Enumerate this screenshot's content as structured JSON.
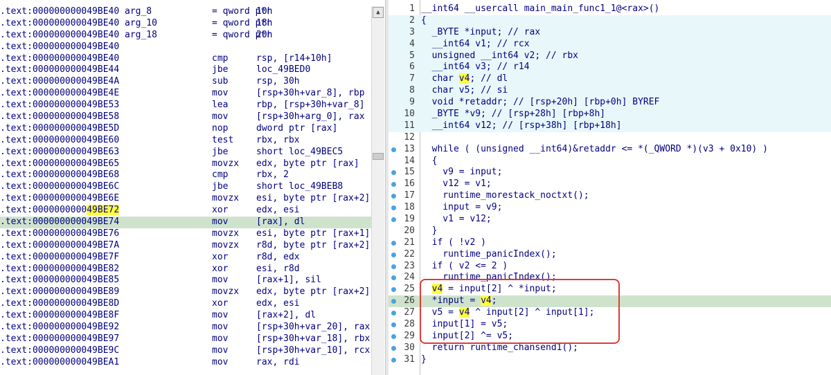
{
  "disassembly": {
    "rows": [
      {
        "addr": ".text:000000000049BE40",
        "label": "arg_8",
        "mnemonic": "= qword ptr",
        "operand": "10h"
      },
      {
        "addr": ".text:000000000049BE40",
        "label": "arg_10",
        "mnemonic": "= qword ptr",
        "operand": "18h"
      },
      {
        "addr": ".text:000000000049BE40",
        "label": "arg_18",
        "mnemonic": "= qword ptr",
        "operand": "20h"
      },
      {
        "addr": ".text:000000000049BE40",
        "label": "",
        "mnemonic": "",
        "operand": ""
      },
      {
        "addr": ".text:000000000049BE40",
        "label": "",
        "mnemonic": "cmp",
        "operand": "rsp, [r14+10h]"
      },
      {
        "addr": ".text:000000000049BE44",
        "label": "",
        "mnemonic": "jbe",
        "operand": "loc_49BED0"
      },
      {
        "addr": ".text:000000000049BE4A",
        "label": "",
        "mnemonic": "sub",
        "operand": "rsp, 30h"
      },
      {
        "addr": ".text:000000000049BE4E",
        "label": "",
        "mnemonic": "mov",
        "operand": "[rsp+30h+var_8], rbp"
      },
      {
        "addr": ".text:000000000049BE53",
        "label": "",
        "mnemonic": "lea",
        "operand": "rbp, [rsp+30h+var_8]"
      },
      {
        "addr": ".text:000000000049BE58",
        "label": "",
        "mnemonic": "mov",
        "operand": "[rsp+30h+arg_0], rax"
      },
      {
        "addr": ".text:000000000049BE5D",
        "label": "",
        "mnemonic": "nop",
        "operand": "dword ptr [rax]"
      },
      {
        "addr": ".text:000000000049BE60",
        "label": "",
        "mnemonic": "test",
        "operand": "rbx, rbx"
      },
      {
        "addr": ".text:000000000049BE63",
        "label": "",
        "mnemonic": "jbe",
        "operand": "short loc_49BEC5"
      },
      {
        "addr": ".text:000000000049BE65",
        "label": "",
        "mnemonic": "movzx",
        "operand": "edx, byte ptr [rax]"
      },
      {
        "addr": ".text:000000000049BE68",
        "label": "",
        "mnemonic": "cmp",
        "operand": "rbx, 2"
      },
      {
        "addr": ".text:000000000049BE6C",
        "label": "",
        "mnemonic": "jbe",
        "operand": "short loc_49BEB8"
      },
      {
        "addr": ".text:000000000049BE6E",
        "label": "",
        "mnemonic": "movzx",
        "operand": "esi, byte ptr [rax+2]"
      },
      {
        "addr": ".text:000000000049BE72",
        "label": "",
        "mnemonic": "xor",
        "operand": "edx, esi"
      },
      {
        "addr": ".text:000000000049BE74",
        "label": "",
        "mnemonic": "mov",
        "operand": "[rax], dl"
      },
      {
        "addr": ".text:000000000049BE76",
        "label": "",
        "mnemonic": "movzx",
        "operand": "esi, byte ptr [rax+1]"
      },
      {
        "addr": ".text:000000000049BE7A",
        "label": "",
        "mnemonic": "movzx",
        "operand": "r8d, byte ptr [rax+2]"
      },
      {
        "addr": ".text:000000000049BE7F",
        "label": "",
        "mnemonic": "xor",
        "operand": "r8d, edx"
      },
      {
        "addr": ".text:000000000049BE82",
        "label": "",
        "mnemonic": "xor",
        "operand": "esi, r8d"
      },
      {
        "addr": ".text:000000000049BE85",
        "label": "",
        "mnemonic": "mov",
        "operand": "[rax+1], sil"
      },
      {
        "addr": ".text:000000000049BE89",
        "label": "",
        "mnemonic": "movzx",
        "operand": "edx, byte ptr [rax+2]"
      },
      {
        "addr": ".text:000000000049BE8D",
        "label": "",
        "mnemonic": "xor",
        "operand": "edx, esi"
      },
      {
        "addr": ".text:000000000049BE8F",
        "label": "",
        "mnemonic": "mov",
        "operand": "[rax+2], dl"
      },
      {
        "addr": ".text:000000000049BE92",
        "label": "",
        "mnemonic": "mov",
        "operand": "[rsp+30h+var_20], rax"
      },
      {
        "addr": ".text:000000000049BE97",
        "label": "",
        "mnemonic": "mov",
        "operand": "[rsp+30h+var_18], rbx"
      },
      {
        "addr": ".text:000000000049BE9C",
        "label": "",
        "mnemonic": "mov",
        "operand": "[rsp+30h+var_10], rcx"
      },
      {
        "addr": ".text:000000000049BEA1",
        "label": "",
        "mnemonic": "mov",
        "operand": "rax, rdi"
      }
    ],
    "highlighted_address_part": "49BE72",
    "selected_row_addr": ".text:000000000049BE74"
  },
  "pseudocode": {
    "lines": [
      {
        "n": "1",
        "text": "__int64 __usercall main_main_func1_1@<rax>()"
      },
      {
        "n": "2",
        "text": "{"
      },
      {
        "n": "3",
        "text": "  _BYTE *input; // rax"
      },
      {
        "n": "4",
        "text": "  __int64 v1; // rcx"
      },
      {
        "n": "5",
        "text": "  unsigned __int64 v2; // rbx"
      },
      {
        "n": "6",
        "text": "  __int64 v3; // r14"
      },
      {
        "n": "7",
        "text": "  char v4; // dl"
      },
      {
        "n": "8",
        "text": "  char v5; // si"
      },
      {
        "n": "9",
        "text": "  void *retaddr; // [rsp+20h] [rbp+0h] BYREF"
      },
      {
        "n": "10",
        "text": "  _BYTE *v9; // [rsp+28h] [rbp+8h]"
      },
      {
        "n": "11",
        "text": "  __int64 v12; // [rsp+38h] [rbp+18h]"
      },
      {
        "n": "12",
        "text": ""
      },
      {
        "n": "13",
        "text": "  while ( (unsigned __int64)&retaddr <= *(_QWORD *)(v3 + 0x10) )"
      },
      {
        "n": "14",
        "text": "  {"
      },
      {
        "n": "15",
        "text": "    v9 = input;"
      },
      {
        "n": "16",
        "text": "    v12 = v1;"
      },
      {
        "n": "17",
        "text": "    runtime_morestack_noctxt();"
      },
      {
        "n": "18",
        "text": "    input = v9;"
      },
      {
        "n": "19",
        "text": "    v1 = v12;"
      },
      {
        "n": "20",
        "text": "  }"
      },
      {
        "n": "21",
        "text": "  if ( !v2 )"
      },
      {
        "n": "22",
        "text": "    runtime_panicIndex();"
      },
      {
        "n": "23",
        "text": "  if ( v2 <= 2 )"
      },
      {
        "n": "24",
        "text": "    runtime_panicIndex();"
      },
      {
        "n": "25",
        "text": "  v4 = input[2] ^ *input;"
      },
      {
        "n": "26",
        "text": "  *input = v4;"
      },
      {
        "n": "27",
        "text": "  v5 = v4 ^ input[2] ^ input[1];"
      },
      {
        "n": "28",
        "text": "  input[1] = v5;"
      },
      {
        "n": "29",
        "text": "  input[2] ^= v5;"
      },
      {
        "n": "30",
        "text": "  return runtime_chansend1();"
      },
      {
        "n": "31",
        "text": "}"
      }
    ]
  },
  "colors": {
    "selection_green": "#cfe3cc",
    "highlight_yellow": "#ffff40",
    "declaration_bg": "#e8f8fa",
    "annotation_red": "#e03a3a",
    "breakpoint_dot": "#4aa3df"
  },
  "icons": {
    "scroll_up": "scroll-up-arrow-icon"
  }
}
